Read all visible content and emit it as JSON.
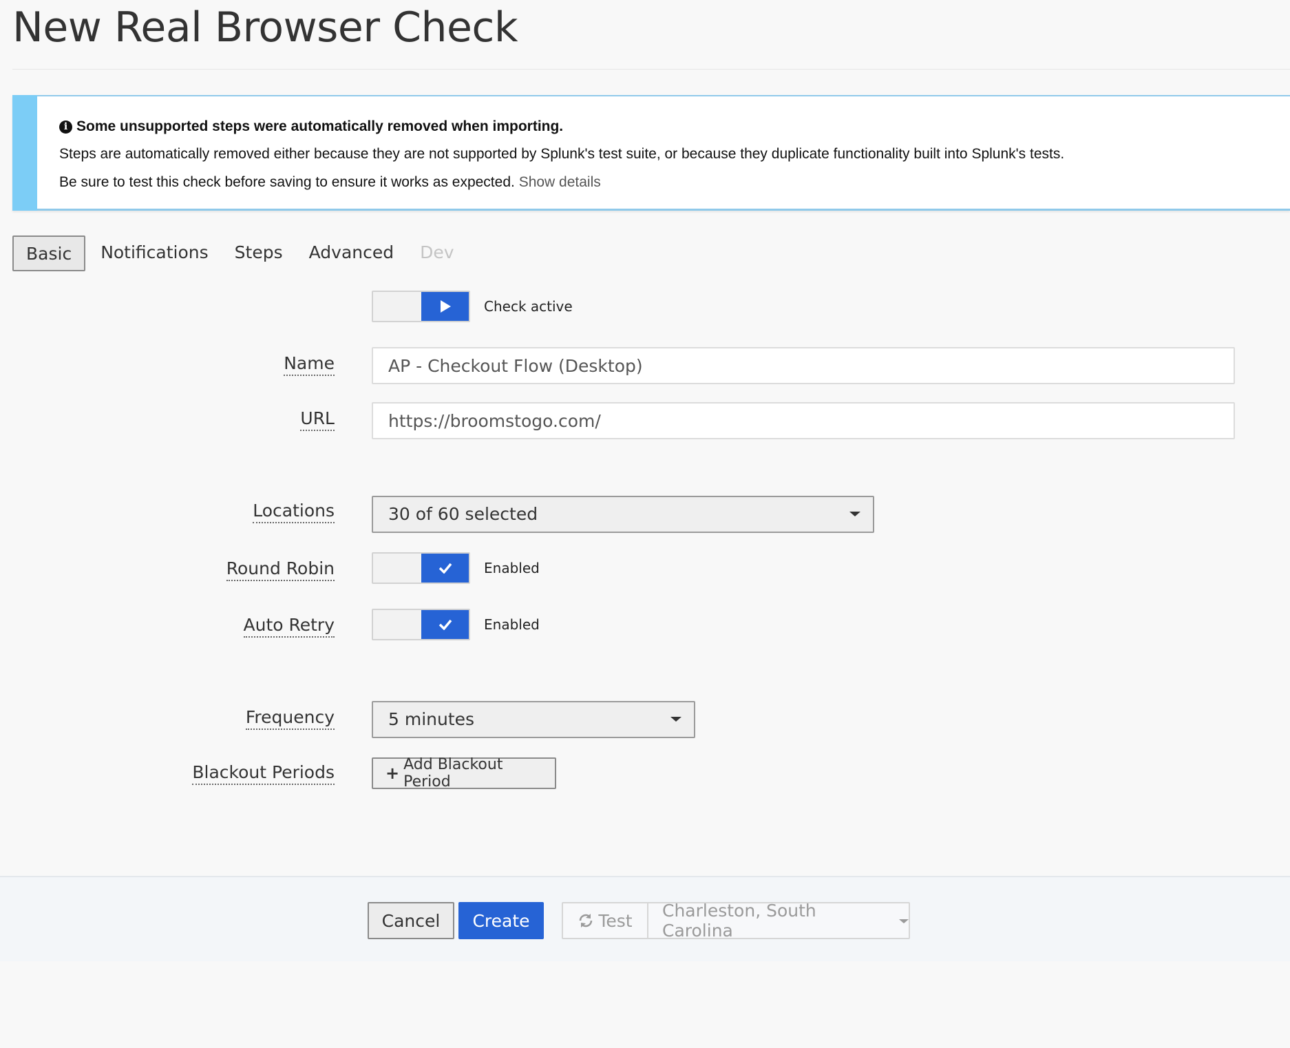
{
  "page": {
    "title": "New Real Browser Check"
  },
  "alert": {
    "heading": "Some unsupported steps were automatically removed when importing.",
    "line1": "Steps are automatically removed either because they are not supported by Splunk's test suite, or because they duplicate functionality built into Splunk's tests.",
    "line2": "Be sure to test this check before saving to ensure it works as expected.",
    "show_details": "Show details",
    "icon": "info-circle-icon",
    "accent_color": "#7ccdf6"
  },
  "tabs": [
    {
      "label": "Basic",
      "active": true
    },
    {
      "label": "Notifications"
    },
    {
      "label": "Steps"
    },
    {
      "label": "Advanced"
    },
    {
      "label": "Dev",
      "disabled": true
    }
  ],
  "form": {
    "check_active": {
      "label": "Check active",
      "on": true,
      "icon": "play-icon"
    },
    "name": {
      "label": "Name",
      "value": "AP - Checkout Flow (Desktop)"
    },
    "url": {
      "label": "URL",
      "value": "https://broomstogo.com/"
    },
    "locations": {
      "label": "Locations",
      "value": "30 of 60 selected"
    },
    "round_robin": {
      "label": "Round Robin",
      "state": "Enabled",
      "icon": "check-icon"
    },
    "auto_retry": {
      "label": "Auto Retry",
      "state": "Enabled",
      "icon": "check-icon"
    },
    "frequency": {
      "label": "Frequency",
      "value": "5 minutes"
    },
    "blackout": {
      "label": "Blackout Periods",
      "button": "Add Blackout Period",
      "icon": "plus-icon"
    }
  },
  "footer": {
    "cancel": "Cancel",
    "create": "Create",
    "test": "Test",
    "test_icon": "refresh-icon",
    "test_location": "Charleston, South Carolina"
  },
  "colors": {
    "primary": "#2663d5",
    "alert_bar": "#7ccdf6"
  }
}
